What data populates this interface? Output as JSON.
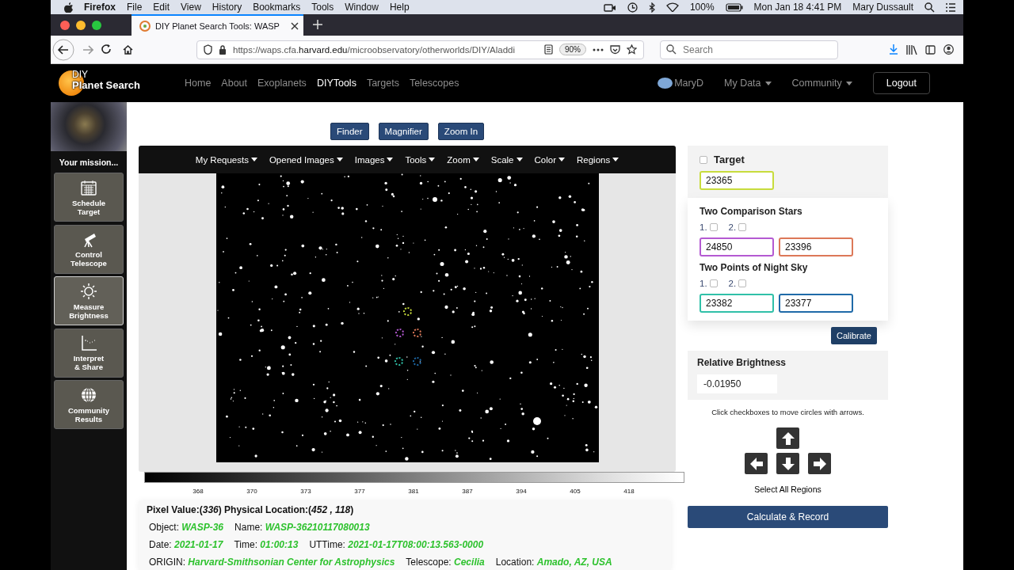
{
  "menubar": {
    "app": "Firefox",
    "menus": [
      "File",
      "Edit",
      "View",
      "History",
      "Bookmarks",
      "Tools",
      "Window",
      "Help"
    ],
    "battery": "100%",
    "clock": "Mon Jan 18  4:41 PM",
    "user": "Mary Dussault"
  },
  "browser": {
    "tab_title": "DIY Planet Search Tools: WASP",
    "url": "https://waps.cfa.**harvard.edu**/microobservatory/otherworlds/DIY/Aladdi",
    "zoom": "90%",
    "search": {
      "placeholder": "Search"
    }
  },
  "site_nav": {
    "logo_top": "DIY",
    "logo_bottom": "Planet Search",
    "links": [
      {
        "label": "Home",
        "selected": false
      },
      {
        "label": "About",
        "selected": false
      },
      {
        "label": "Exoplanets",
        "selected": false
      },
      {
        "label": "DIYTools",
        "selected": true
      },
      {
        "label": "Targets",
        "selected": false
      },
      {
        "label": "Telescopes",
        "selected": false
      }
    ],
    "user": "MaryD",
    "menus": [
      "My Data",
      "Community"
    ],
    "logout": "Logout"
  },
  "sidebar": {
    "mission": "Your mission...",
    "items": [
      {
        "kind": "calendar",
        "label": "Schedule\nTarget",
        "selected": false
      },
      {
        "kind": "telescope",
        "label": "Control\nTelescope",
        "selected": false
      },
      {
        "kind": "sun",
        "label": "Measure\nBrightness",
        "selected": true
      },
      {
        "kind": "graph",
        "label": "Interpret\n& Share",
        "selected": false
      },
      {
        "kind": "globe",
        "label": "Community\nResults",
        "selected": false
      }
    ]
  },
  "tools": {
    "buttons": [
      "Finder",
      "Magnifier",
      "Zoom In"
    ]
  },
  "viewer": {
    "menus": [
      "My Requests",
      "Opened Images",
      "Images",
      "Tools",
      "Zoom",
      "Scale",
      "Color",
      "Regions"
    ],
    "colorbar_ticks": [
      "368",
      "370",
      "373",
      "377",
      "381",
      "387",
      "394",
      "405",
      "418"
    ]
  },
  "info": {
    "pixel_line": "Pixel Value:(*336*) Physical Location:(*452 , 118*)",
    "lines": [
      {
        "items": [
          {
            "label": "Object:",
            "value": "WASP-36"
          },
          {
            "label": "Name:",
            "value": "WASP-36210117080013"
          }
        ]
      },
      {
        "items": [
          {
            "label": "Date:",
            "value": "2021-01-17"
          },
          {
            "label": "Time:",
            "value": "01:00:13"
          },
          {
            "label": "UTTime:",
            "value": "2021-01-17T08:00:13.563-0000"
          }
        ]
      },
      {
        "items": [
          {
            "label": "ORIGIN:",
            "value": "Harvard-Smithsonian Center for Astrophysics"
          },
          {
            "label": "Telescope:",
            "value": "Cecilia"
          },
          {
            "label": "Location:",
            "value": "Amado, AZ, USA"
          }
        ]
      }
    ]
  },
  "measure": {
    "target": {
      "label": "Target",
      "checked": false,
      "value": "23365",
      "color": "#c8dc3c"
    },
    "comparison": {
      "title": "Two Comparison Stars",
      "checks": [
        {
          "label": "1.",
          "checked": false
        },
        {
          "label": "2.",
          "checked": false
        }
      ],
      "fields": [
        {
          "value": "24850",
          "color": "#b45ad2"
        },
        {
          "value": "23396",
          "color": "#dc7858"
        }
      ]
    },
    "sky": {
      "title": "Two Points of Night Sky",
      "checks": [
        {
          "label": "1.",
          "checked": false
        },
        {
          "label": "2.",
          "checked": false
        }
      ],
      "fields": [
        {
          "value": "23382",
          "color": "#30c0a8"
        },
        {
          "value": "23377",
          "color": "#1f6aa8"
        }
      ]
    },
    "calibrate": "Calibrate",
    "relative": {
      "title": "Relative Brightness",
      "value": "-0.01950"
    },
    "hint": "Click checkboxes to move circles with arrows.",
    "select_all": "Select All Regions",
    "calculate": "Calculate & Record"
  }
}
